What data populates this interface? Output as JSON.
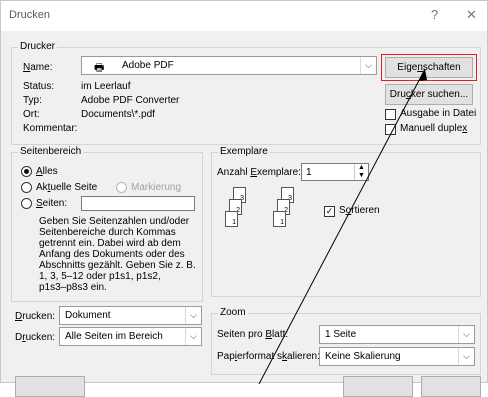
{
  "window": {
    "title": "Drucken",
    "help": "?",
    "close": "✕"
  },
  "printer": {
    "legend": "Drucker",
    "name_label": "Name:",
    "name_value": "Adobe PDF",
    "status_label": "Status:",
    "status_value": "im Leerlauf",
    "type_label": "Typ:",
    "type_value": "Adobe PDF Converter",
    "location_label": "Ort:",
    "location_value": "Documents\\*.pdf",
    "comment_label": "Kommentar:",
    "properties_button": "Eigenschaften",
    "find_printer_button": "Drucker suchen...",
    "print_to_file_label": "Ausgabe in Datei",
    "manual_duplex_label": "Manuell duplex"
  },
  "range": {
    "legend": "Seitenbereich",
    "all_label": "Alles",
    "current_page_label": "Aktuelle Seite",
    "selection_label": "Markierung",
    "pages_label": "Seiten:",
    "help_lines": [
      "Geben Sie Seitenzahlen und/oder",
      "Seitenbereiche durch Kommas",
      "getrennt ein. Dabei wird ab dem",
      "Anfang des Dokuments oder des",
      "Abschnitts gezählt. Geben Sie z. B.",
      "1, 3, 5–12 oder p1s1, p1s2,",
      "p1s3–p8s3 ein."
    ]
  },
  "copies": {
    "legend": "Exemplare",
    "count_label": "Anzahl Exemplare:",
    "count_value": "1",
    "collate_label": "Sortieren",
    "page_numbers": [
      "1",
      "2",
      "3"
    ]
  },
  "print_what": {
    "label": "Drucken:",
    "value": "Dokument"
  },
  "print": {
    "label": "Drucken:",
    "value": "Alle Seiten im Bereich"
  },
  "zoom": {
    "legend": "Zoom",
    "pages_per_sheet_label": "Seiten pro Blatt:",
    "pages_per_sheet_value": "1 Seite",
    "scale_label": "Papierformat skalieren:",
    "scale_value": "Keine Skalierung"
  },
  "colors": {
    "highlight": "#e02020"
  }
}
